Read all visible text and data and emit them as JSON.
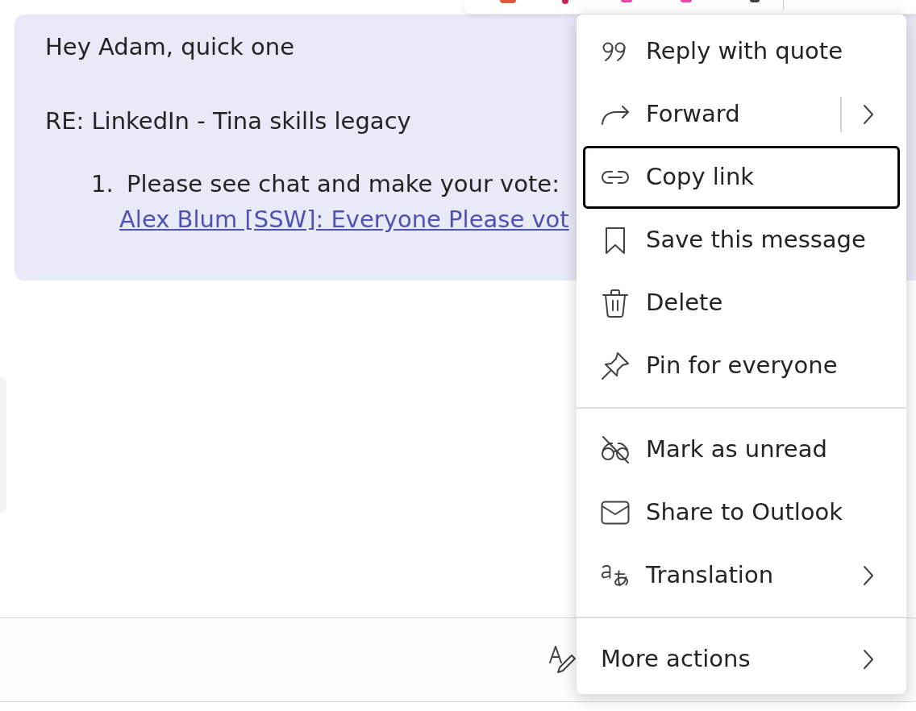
{
  "message": {
    "paragraphs": [
      "Hey Adam, quick one",
      "RE: LinkedIn - Tina skills legacy"
    ],
    "list": [
      {
        "number": "1.",
        "text": "Please see chat and make your vote:",
        "link": "Alex Blum [SSW]: Everyone Please vot"
      }
    ]
  },
  "context_menu": {
    "groups": [
      [
        {
          "label": "Reply with quote",
          "kind": "action",
          "focused": false
        },
        {
          "label": "Forward",
          "kind": "split",
          "focused": false
        },
        {
          "label": "Copy link",
          "kind": "action",
          "focused": true
        },
        {
          "label": "Save this message",
          "kind": "action",
          "focused": false
        },
        {
          "label": "Delete",
          "kind": "action",
          "focused": false
        },
        {
          "label": "Pin for everyone",
          "kind": "action",
          "focused": false
        }
      ],
      [
        {
          "label": "Mark as unread",
          "kind": "action",
          "focused": false
        },
        {
          "label": "Share to Outlook",
          "kind": "action",
          "focused": false
        },
        {
          "label": "Translation",
          "kind": "submenu",
          "focused": false
        }
      ],
      [
        {
          "label": "More actions",
          "kind": "submenu",
          "focused": false
        }
      ]
    ]
  }
}
